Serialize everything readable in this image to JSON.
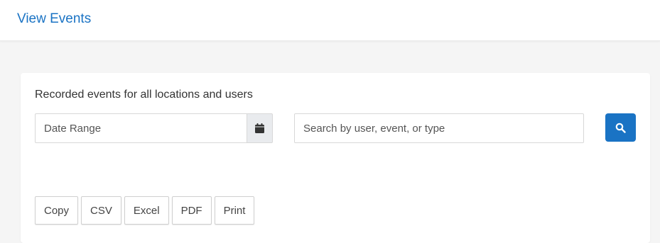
{
  "header": {
    "title": "View Events",
    "title_color": "#1a73c4"
  },
  "card": {
    "heading": "Recorded events for all locations and users",
    "date_range": {
      "placeholder": "Date Range",
      "value": "",
      "icon": "calendar-icon"
    },
    "search": {
      "placeholder": "Search by user, event, or type",
      "value": "",
      "button_icon": "search-icon",
      "button_color": "#1a73c4"
    },
    "export_buttons": [
      {
        "label": "Copy"
      },
      {
        "label": "CSV"
      },
      {
        "label": "Excel"
      },
      {
        "label": "PDF"
      },
      {
        "label": "Print"
      }
    ]
  }
}
